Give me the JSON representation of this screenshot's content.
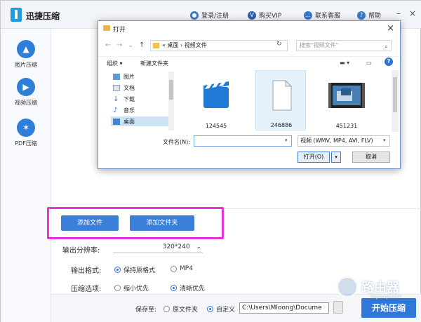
{
  "app": {
    "title": "迅捷压缩",
    "login": "登录/注册",
    "buy_vip": "购买VIP",
    "support": "联系客服",
    "help": "帮助",
    "brand_color": "#2f78d8"
  },
  "sidebar": {
    "items": [
      {
        "label": "图片压缩",
        "icon": "image-icon",
        "color": "#2f7fd9"
      },
      {
        "label": "视频压缩",
        "icon": "play-icon",
        "color": "#2f7fd9"
      },
      {
        "label": "PDF压缩",
        "icon": "pdf-icon",
        "color": "#2f7fd9"
      }
    ]
  },
  "main": {
    "add_file": "添加文件",
    "add_folder": "添加文件夹",
    "resolution_label": "输出分辨率:",
    "resolution_value": "320*240",
    "format_label": "输出格式:",
    "format_options": [
      "保持原格式",
      "MP4"
    ],
    "format_selected": "保持原格式",
    "compress_label": "压缩选项:",
    "compress_options": [
      "缩小优先",
      "清晰优先"
    ],
    "compress_selected": "清晰优先"
  },
  "bottom": {
    "save_to_label": "保存至:",
    "save_options": [
      "原文件夹",
      "自定义"
    ],
    "save_selected": "自定义",
    "path": "C:\\Users\\Mloong\\Docume",
    "start_button": "开始压缩"
  },
  "dialog": {
    "title": "打开",
    "breadcrumb_prefix": "«",
    "breadcrumb": [
      "桌面",
      "视频文件"
    ],
    "search_placeholder": "搜索\"视频文件\"",
    "organize": "组织 ▾",
    "new_folder": "新建文件夹",
    "tree": [
      {
        "label": "图片",
        "icon": "pictures-icon"
      },
      {
        "label": "文档",
        "icon": "documents-icon"
      },
      {
        "label": "下载",
        "icon": "download-icon"
      },
      {
        "label": "音乐",
        "icon": "music-icon"
      },
      {
        "label": "桌面",
        "icon": "desktop-icon",
        "selected": true
      }
    ],
    "files": [
      {
        "name": "124545",
        "icon": "video-clapper-icon"
      },
      {
        "name": "246886",
        "icon": "blank-file-icon",
        "selected": true
      },
      {
        "name": "451231",
        "icon": "video-thumbnail-icon"
      }
    ],
    "filename_label": "文件名(N):",
    "filename_value": "",
    "filter": "视频 (WMV, MP4, AVI, FLV)",
    "open_button": "打开(O)",
    "cancel_button": "取消"
  },
  "watermark": {
    "text": "路由器",
    "sub": "luyouqi.com"
  }
}
